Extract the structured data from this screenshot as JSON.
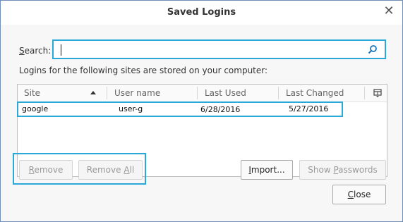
{
  "window": {
    "title": "Saved Logins",
    "close_icon": "close-icon"
  },
  "search": {
    "label_prefix": "",
    "label_accel": "S",
    "label_rest": "earch:",
    "value": "",
    "icon": "search-icon"
  },
  "info_text": "Logins for the following sites are stored on your computer:",
  "table": {
    "columns": [
      "Site",
      "User name",
      "Last Used",
      "Last Changed"
    ],
    "sort_icon": "sort-ascending-icon",
    "column_picker_icon": "column-picker-icon",
    "rows": [
      {
        "site": "google",
        "username": "user-g",
        "last_used": "6/28/2016",
        "last_changed": "5/27/2016"
      }
    ]
  },
  "buttons": {
    "remove": "Remove",
    "remove_all": "Remove All",
    "import": "Import...",
    "show_passwords": "Show Passwords",
    "close": "Close"
  },
  "colors": {
    "highlight": "#2aa8d8",
    "window_border": "#6f8fb8"
  }
}
